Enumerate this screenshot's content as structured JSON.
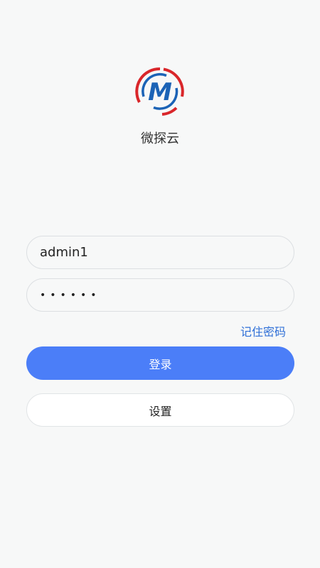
{
  "app": {
    "name": "微探云",
    "logo_letter": "M"
  },
  "form": {
    "username_value": "admin1",
    "password_value": "••••••",
    "remember_label": "记住密码",
    "login_label": "登录",
    "settings_label": "设置"
  },
  "colors": {
    "background": "#f7f8f8",
    "primary": "#4b7ef8",
    "link": "#2e6fd7",
    "logo_red": "#d9262a",
    "logo_blue": "#1b63b6"
  }
}
